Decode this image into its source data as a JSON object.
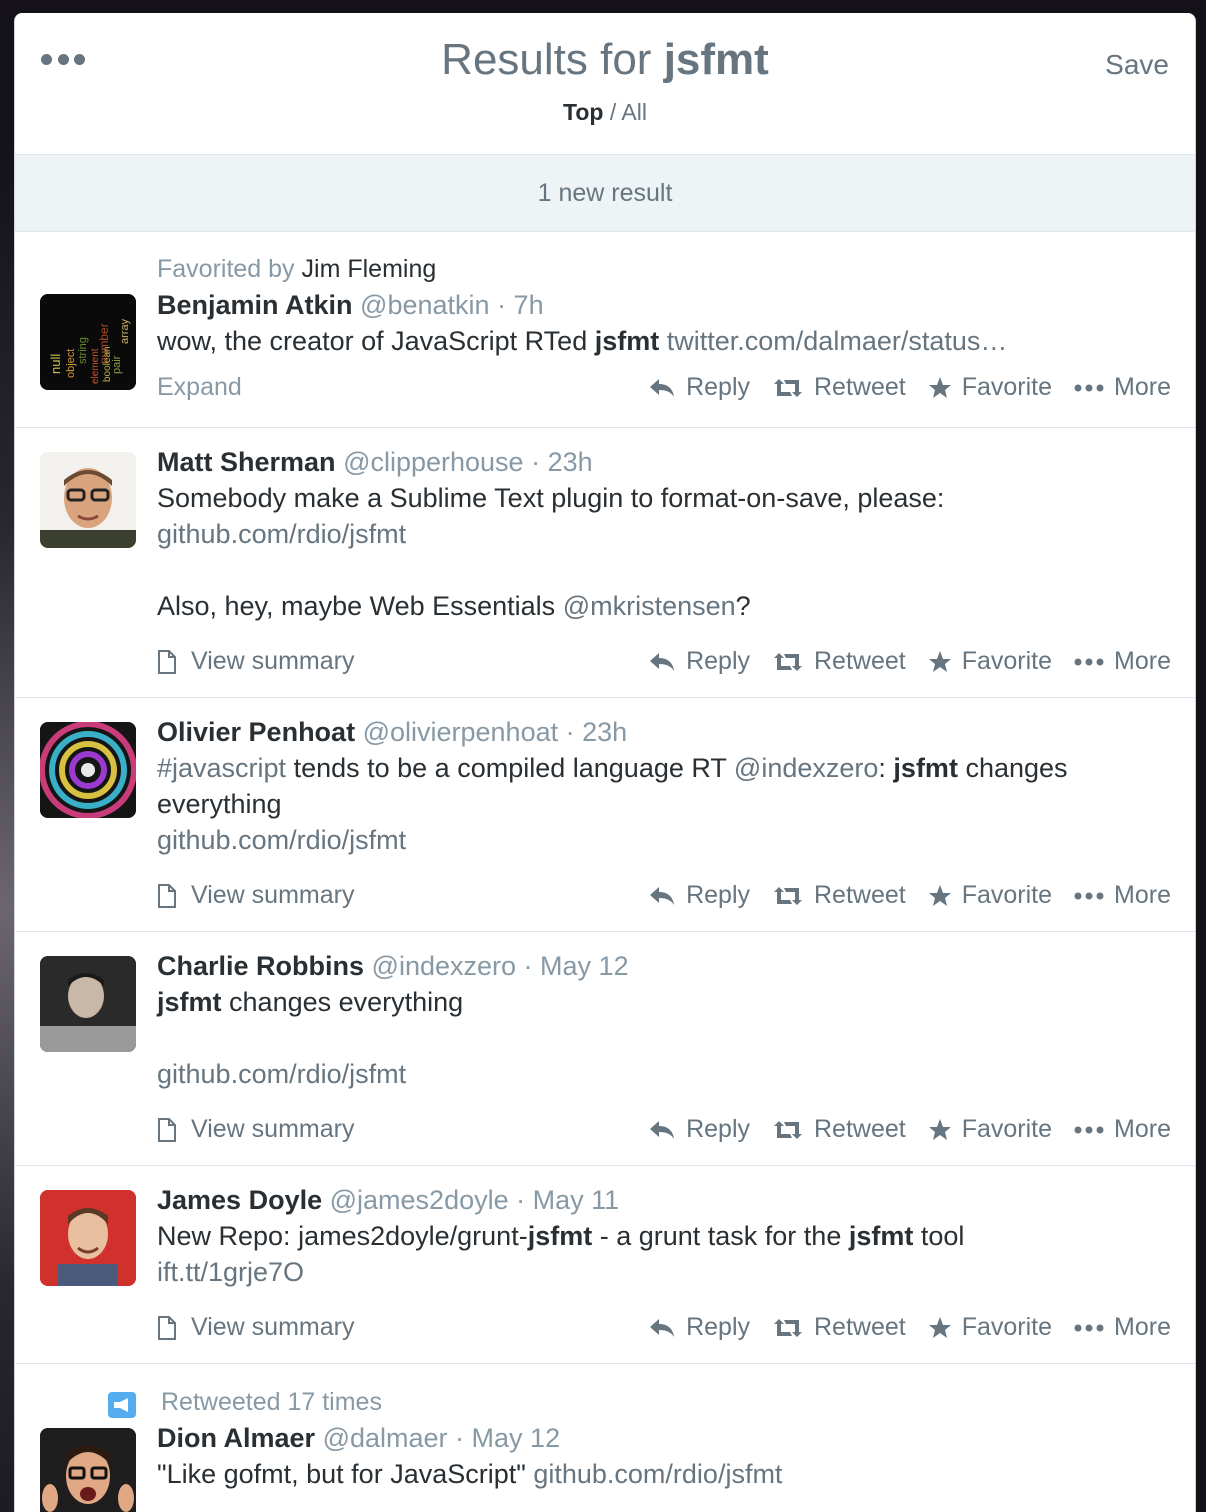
{
  "header": {
    "title_prefix": "Results for",
    "query": "jsfmt",
    "filter_top": "Top",
    "filter_sep": "/",
    "filter_all": "All",
    "save_label": "Save"
  },
  "new_results": "1 new result",
  "actions": {
    "reply": "Reply",
    "retweet": "Retweet",
    "favorite": "Favorite",
    "more": "More",
    "expand": "Expand",
    "view_summary": "View summary"
  },
  "tweets": [
    {
      "context_label": "Favorited by",
      "context_who": "Jim Fleming",
      "name": "Benjamin Atkin",
      "handle": "@benatkin",
      "time": "· 7h",
      "text_pre": "wow, the creator of JavaScript RTed",
      "text_bold": "jsfmt",
      "text_link": "twitter.com/dalmaer/status…"
    },
    {
      "name": "Matt Sherman",
      "handle": "@clipperhouse",
      "time": "· 23h",
      "line1": "Somebody make a Sublime Text plugin to format-on-save, please:",
      "link1": "github.com/rdio/jsfmt",
      "line2_pre": "Also, hey, maybe Web Essentials",
      "line2_mention": "@mkristensen",
      "line2_post": "?"
    },
    {
      "name": "Olivier Penhoat",
      "handle": "@olivierpenhoat",
      "time": "· 23h",
      "hashtag": "#javascript",
      "mid": "tends to be a compiled language RT",
      "mention": "@indexzero",
      "colon": ":",
      "bold": "jsfmt",
      "tail": "changes everything",
      "link": "github.com/rdio/jsfmt"
    },
    {
      "name": "Charlie Robbins",
      "handle": "@indexzero",
      "time": "· May 12",
      "bold": "jsfmt",
      "tail": "changes everything",
      "link": "github.com/rdio/jsfmt"
    },
    {
      "name": "James Doyle",
      "handle": "@james2doyle",
      "time": "· May 11",
      "pre": "New Repo: james2doyle/grunt-",
      "bold1": "jsfmt",
      "mid": "- a grunt task for the",
      "bold2": "jsfmt",
      "tail": "tool",
      "link": "ift.tt/1grje7O"
    },
    {
      "context_label": "Retweeted 17 times",
      "name": "Dion Almaer",
      "handle": "@dalmaer",
      "time": "· May 12",
      "quote": "\"Like gofmt, but for JavaScript\"",
      "link": "github.com/rdio/jsfmt"
    }
  ]
}
